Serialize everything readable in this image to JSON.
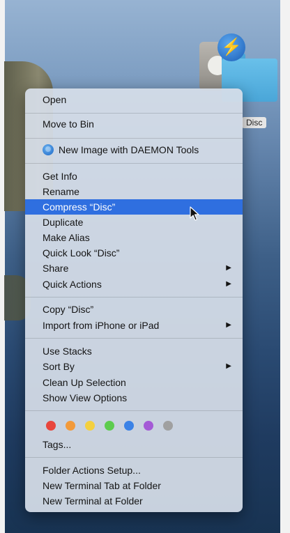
{
  "desktop": {
    "file_label": "Disc"
  },
  "menu": {
    "open": "Open",
    "move_to_bin": "Move to Bin",
    "new_image_daemon": "New Image with DAEMON Tools",
    "get_info": "Get Info",
    "rename": "Rename",
    "compress": "Compress “Disc”",
    "duplicate": "Duplicate",
    "make_alias": "Make Alias",
    "quick_look": "Quick Look “Disc”",
    "share": "Share",
    "quick_actions": "Quick Actions",
    "copy": "Copy “Disc”",
    "import_iphone": "Import from iPhone or iPad",
    "use_stacks": "Use Stacks",
    "sort_by": "Sort By",
    "clean_up": "Clean Up Selection",
    "show_view_options": "Show View Options",
    "tags": "Tags...",
    "folder_actions": "Folder Actions Setup...",
    "new_terminal_tab": "New Terminal Tab at Folder",
    "new_terminal": "New Terminal at Folder",
    "submenu_arrow": "▶"
  },
  "tag_colors": [
    {
      "name": "red",
      "color": "#e8453c"
    },
    {
      "name": "orange",
      "color": "#f29a3a"
    },
    {
      "name": "yellow",
      "color": "#f4d03f"
    },
    {
      "name": "green",
      "color": "#5dcc4e"
    },
    {
      "name": "blue",
      "color": "#3b82e6"
    },
    {
      "name": "purple",
      "color": "#a45ad6"
    },
    {
      "name": "gray",
      "color": "#a0a0a0"
    }
  ],
  "colors": {
    "highlight": "#2f6fe0"
  }
}
